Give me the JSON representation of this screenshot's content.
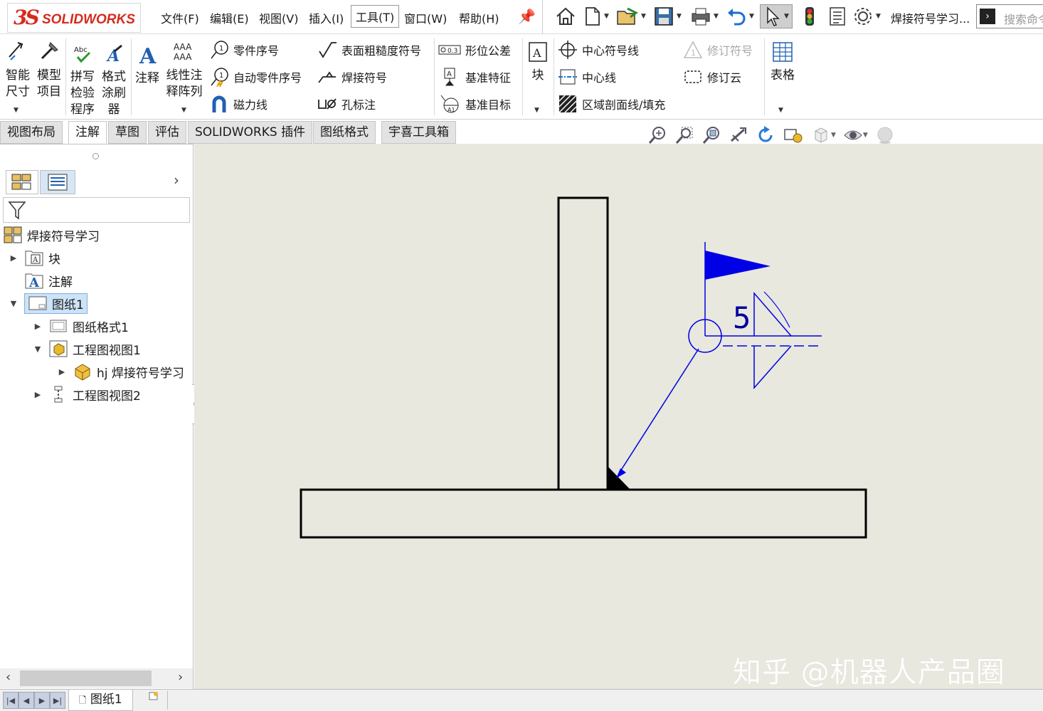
{
  "app": {
    "logo_text": "SOLIDWORKS",
    "logo_mark": "3S"
  },
  "menu": {
    "items": [
      "文件(F)",
      "编辑(E)",
      "视图(V)",
      "插入(I)",
      "工具(T)",
      "窗口(W)",
      "帮助(H)"
    ],
    "active": "工具(T)"
  },
  "document_title": "焊接符号学习...",
  "search": {
    "placeholder": "搜索命令"
  },
  "ribbon": {
    "smart_dim": "智能尺寸",
    "model_items": "模型项目",
    "spell_check": "拼写检验程序",
    "format_painter": "格式涂刷器",
    "note": "注释",
    "linear_pattern": "线性注释阵列",
    "balloon": "零件序号",
    "auto_balloon": "自动零件序号",
    "magnetic_line": "磁力线",
    "surface_finish": "表面粗糙度符号",
    "weld_symbol": "焊接符号",
    "hole_callout": "孔标注",
    "gtol": "形位公差",
    "datum_feature": "基准特征",
    "datum_target": "基准目标",
    "block": "块",
    "center_mark": "中心符号线",
    "centerline": "中心线",
    "hatch": "区域剖面线/填充",
    "revision_symbol": "修订符号",
    "revision_cloud": "修订云",
    "table": "表格"
  },
  "tabs": [
    "视图布局",
    "注解",
    "草图",
    "评估",
    "SOLIDWORKS 插件",
    "图纸格式",
    "宇喜工具箱"
  ],
  "active_tab": "注解",
  "tree": {
    "root": "焊接符号学习",
    "blocks": "块",
    "annotations": "注解",
    "sheet": "图纸1",
    "sheet_format": "图纸格式1",
    "drawing_view1": "工程图视图1",
    "part": "hj 焊接符号学习",
    "drawing_view2": "工程图视图2"
  },
  "weld": {
    "size": "5"
  },
  "colors": {
    "weld_blue": "#0000e6",
    "canvas": "#e8e8de",
    "accent": "#1c6fd1",
    "logo_red": "#d52b1e"
  },
  "watermark": "知乎 @机器人产品圈",
  "bottom": {
    "sheet_tab": "图纸1"
  }
}
